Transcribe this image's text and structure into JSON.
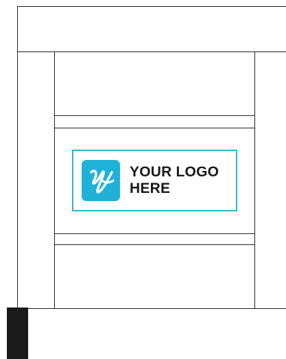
{
  "logo": {
    "line1": "YOUR LOGO",
    "line2": "HERE",
    "icon": "signature-y-icon",
    "accent_color": "#29b6cf",
    "icon_color": "#1fb2d6"
  }
}
